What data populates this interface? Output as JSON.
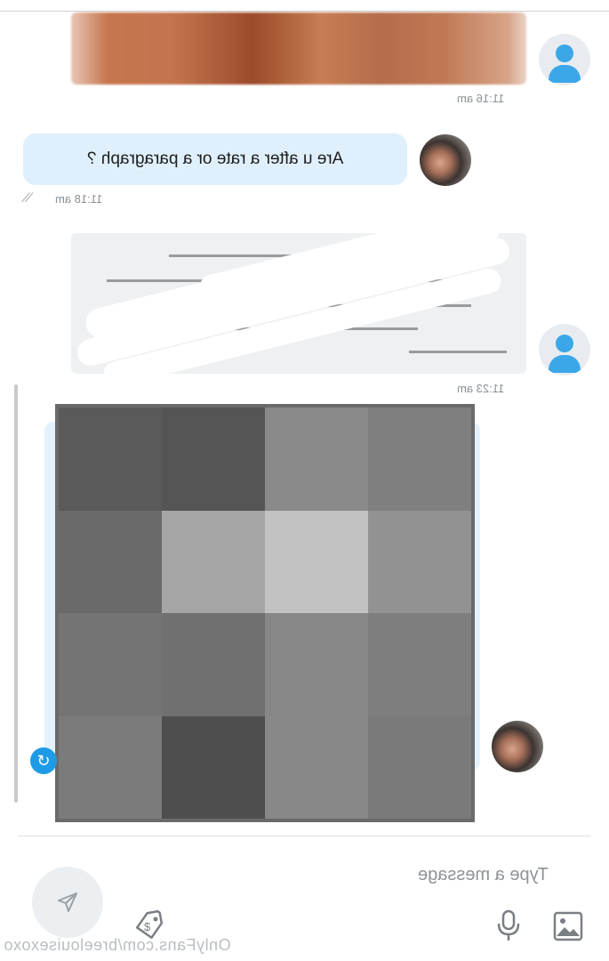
{
  "messages": {
    "first": {
      "time": "11:16 am"
    },
    "second": {
      "text": "Are u after a rate or a paragraph ?",
      "time": "11:18 am"
    },
    "third": {
      "time": "11:23 am"
    }
  },
  "composer": {
    "placeholder": "Type a message",
    "icons": [
      "image-icon",
      "microphone-icon",
      "price-tag-icon",
      "send-icon"
    ]
  },
  "watermark": "OnlyFans.com/breelouisexoxo",
  "colors": {
    "accent": "#1e9be6",
    "incoming_bubble": "#dff0fc",
    "outgoing_bubble": "#eef0f2"
  }
}
